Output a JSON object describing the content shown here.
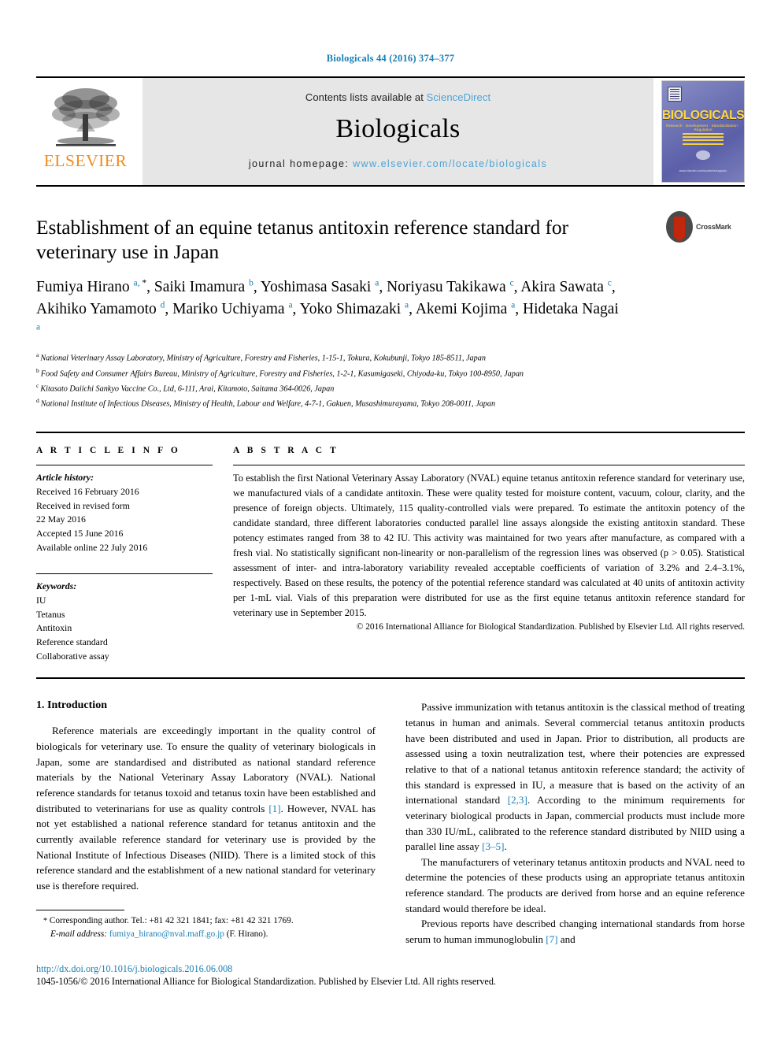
{
  "running_head": "Biologicals 44 (2016) 374–377",
  "masthead": {
    "publisher_name": "ELSEVIER",
    "contents_prefix": "Contents lists available at ",
    "sciencedirect": "ScienceDirect",
    "journal_title": "Biologicals",
    "homepage_prefix": "journal homepage: ",
    "homepage_url": "www.elsevier.com/locate/biologicals",
    "cover": {
      "title": "BIOLOGICALS",
      "subtitle": "Research · Development · Standardisation · Regulation",
      "footer": "www.elsevier.com/locate/biologicals"
    },
    "accent_link_color": "#4ba3d3"
  },
  "article": {
    "title": "Establishment of an equine tetanus antitoxin reference standard for veterinary use in Japan",
    "crossmark_label": "CrossMark",
    "authors": [
      {
        "name": "Fumiya Hirano",
        "marks": "a, *",
        "sep": ", "
      },
      {
        "name": "Saiki Imamura",
        "marks": "b",
        "sep": ", "
      },
      {
        "name": "Yoshimasa Sasaki",
        "marks": "a",
        "sep": ", "
      },
      {
        "name": "Noriyasu Takikawa",
        "marks": "c",
        "sep": ", "
      },
      {
        "name": "Akira Sawata",
        "marks": "c",
        "sep": ", "
      },
      {
        "name": "Akihiko Yamamoto",
        "marks": "d",
        "sep": ", "
      },
      {
        "name": "Mariko Uchiyama",
        "marks": "a",
        "sep": ", "
      },
      {
        "name": "Yoko Shimazaki",
        "marks": "a",
        "sep": ", "
      },
      {
        "name": "Akemi Kojima",
        "marks": "a",
        "sep": ", "
      },
      {
        "name": "Hidetaka Nagai",
        "marks": "a",
        "sep": ""
      }
    ],
    "affiliations": [
      {
        "mark": "a",
        "text": "National Veterinary Assay Laboratory, Ministry of Agriculture, Forestry and Fisheries, 1-15-1, Tokura, Kokubunji, Tokyo 185-8511, Japan"
      },
      {
        "mark": "b",
        "text": "Food Safety and Consumer Affairs Bureau, Ministry of Agriculture, Forestry and Fisheries, 1-2-1, Kasumigaseki, Chiyoda-ku, Tokyo 100-8950, Japan"
      },
      {
        "mark": "c",
        "text": "Kitasato Daiichi Sankyo Vaccine Co., Ltd, 6-111, Arai, Kitamoto, Saitama 364-0026, Japan"
      },
      {
        "mark": "d",
        "text": "National Institute of Infectious Diseases, Ministry of Health, Labour and Welfare, 4-7-1, Gakuen, Musashimurayama, Tokyo 208-0011, Japan"
      }
    ]
  },
  "article_info": {
    "heading": "A R T I C L E   I N F O",
    "history_label": "Article history:",
    "history": [
      "Received 16 February 2016",
      "Received in revised form",
      "22 May 2016",
      "Accepted 15 June 2016",
      "Available online 22 July 2016"
    ],
    "keywords_label": "Keywords:",
    "keywords": [
      "IU",
      "Tetanus",
      "Antitoxin",
      "Reference standard",
      "Collaborative assay"
    ]
  },
  "abstract": {
    "heading": "A B S T R A C T",
    "text": "To establish the first National Veterinary Assay Laboratory (NVAL) equine tetanus antitoxin reference standard for veterinary use, we manufactured vials of a candidate antitoxin. These were quality tested for moisture content, vacuum, colour, clarity, and the presence of foreign objects. Ultimately, 115 quality-controlled vials were prepared. To estimate the antitoxin potency of the candidate standard, three different laboratories conducted parallel line assays alongside the existing antitoxin standard. These potency estimates ranged from 38 to 42 IU. This activity was maintained for two years after manufacture, as compared with a fresh vial. No statistically significant non-linearity or non-parallelism of the regression lines was observed (p > 0.05). Statistical assessment of inter- and intra-laboratory variability revealed acceptable coefficients of variation of 3.2% and 2.4–3.1%, respectively. Based on these results, the potency of the potential reference standard was calculated at 40 units of antitoxin activity per 1-mL vial. Vials of this preparation were distributed for use as the first equine tetanus antitoxin reference standard for veterinary use in September 2015.",
    "copyright": "© 2016 International Alliance for Biological Standardization. Published by Elsevier Ltd. All rights reserved."
  },
  "introduction": {
    "section_number": "1.",
    "section_title": "Introduction",
    "left_paragraphs": [
      {
        "part1": "Reference materials are exceedingly important in the quality control of biologicals for veterinary use. To ensure the quality of veterinary biologicals in Japan, some are standardised and distributed as national standard reference materials by the National Veterinary Assay Laboratory (NVAL). National reference standards for tetanus toxoid and tetanus toxin have been established and distributed to veterinarians for use as quality controls ",
        "cite": "[1]",
        "part2": ". However, NVAL has not yet established a national reference standard for tetanus antitoxin and the currently available reference standard for veterinary use is provided by the National Institute of Infectious Diseases (NIID). There is a limited stock of this reference standard and the establishment of a new national standard for veterinary use is therefore required."
      }
    ],
    "right_paragraphs": [
      {
        "part1": "Passive immunization with tetanus antitoxin is the classical method of treating tetanus in human and animals. Several commercial tetanus antitoxin products have been distributed and used in Japan. Prior to distribution, all products are assessed using a toxin neutralization test, where their potencies are expressed relative to that of a national tetanus antitoxin reference standard; the activity of this standard is expressed in IU, a measure that is based on the activity of an international standard ",
        "cite": "[2,3]",
        "part2": ". According to the minimum requirements for veterinary biological products in Japan, commercial products must include more than 330 IU/mL, calibrated to the reference standard distributed by NIID using a parallel line assay ",
        "cite2": "[3–5]",
        "part3": "."
      },
      {
        "part1": "The manufacturers of veterinary tetanus antitoxin products and NVAL need to determine the potencies of these products using an appropriate tetanus antitoxin reference standard. The products are derived from horse and an equine reference standard would therefore be ideal.",
        "cite": "",
        "part2": ""
      },
      {
        "part1": "Previous reports have described changing international standards from horse serum to human immunoglobulin ",
        "cite": "[7]",
        "part2": " and"
      }
    ]
  },
  "footnotes": {
    "corresponding_star": "*",
    "corresponding_text": "Corresponding author. Tel.: +81 42 321 1841; fax: +81 42 321 1769.",
    "email_label": "E-mail address:",
    "email": "fumiya_hirano@nval.maff.go.jp",
    "email_owner": "(F. Hirano)."
  },
  "page_footer": {
    "doi": "http://dx.doi.org/10.1016/j.biologicals.2016.06.008",
    "issn_line": "1045-1056/© 2016 International Alliance for Biological Standardization. Published by Elsevier Ltd. All rights reserved."
  }
}
